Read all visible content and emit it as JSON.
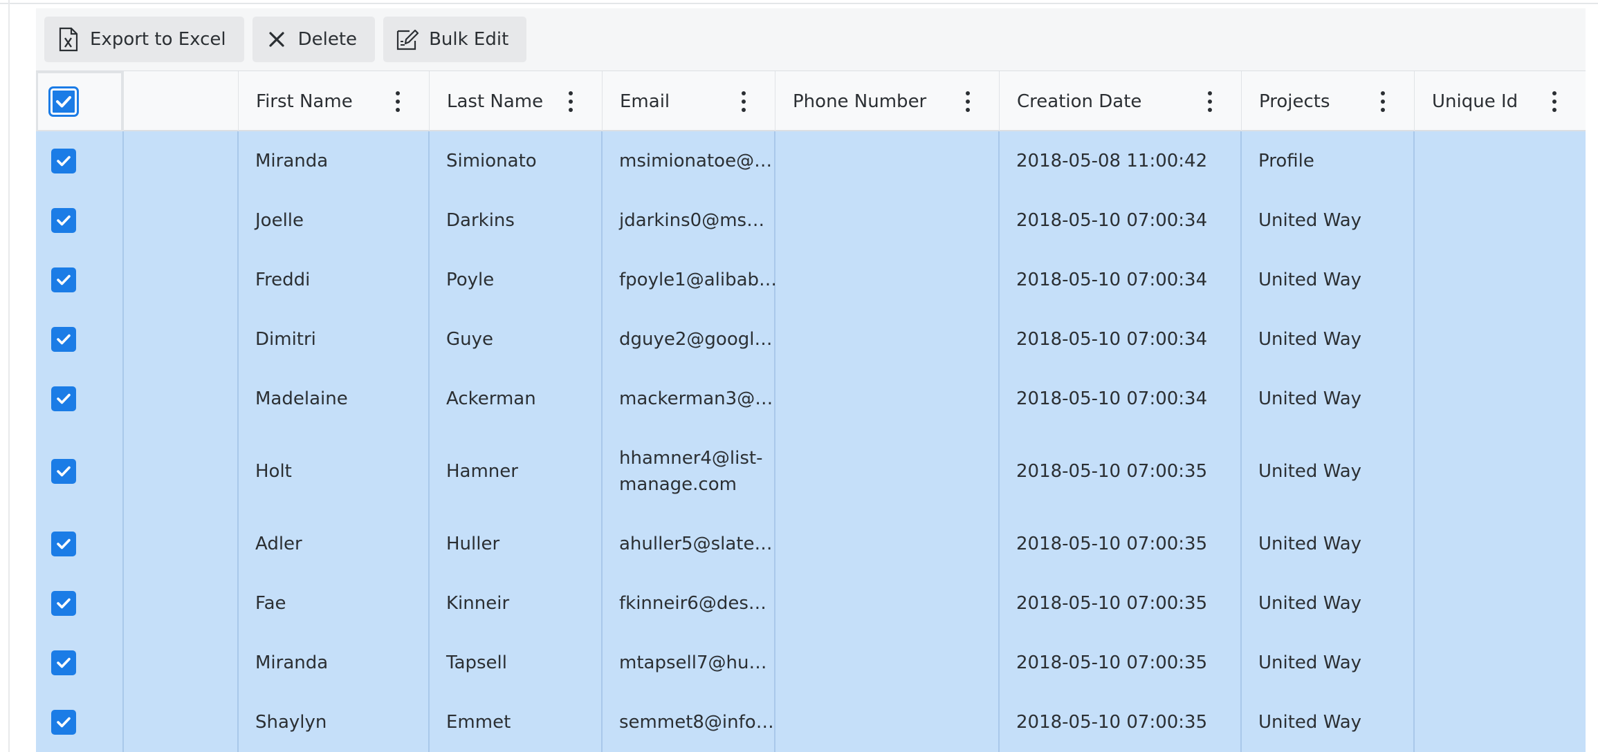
{
  "toolbar": {
    "export_label": "Export to Excel",
    "delete_label": "Delete",
    "bulk_edit_label": "Bulk Edit"
  },
  "columns": [
    {
      "label": "First Name"
    },
    {
      "label": "Last Name"
    },
    {
      "label": "Email"
    },
    {
      "label": "Phone Number"
    },
    {
      "label": "Creation Date"
    },
    {
      "label": "Projects"
    },
    {
      "label": "Unique Id"
    }
  ],
  "header_select_all_checked": true,
  "rows": [
    {
      "checked": true,
      "first": "Miranda",
      "last": "Simionato",
      "email": "msimionatoe@…",
      "phone": "",
      "created": "2018-05-08 11:00:42",
      "projects": "Profile",
      "unique_id": ""
    },
    {
      "checked": true,
      "first": "Joelle",
      "last": "Darkins",
      "email": "jdarkins0@ms…",
      "phone": "",
      "created": "2018-05-10 07:00:34",
      "projects": "United Way",
      "unique_id": ""
    },
    {
      "checked": true,
      "first": "Freddi",
      "last": "Poyle",
      "email": "fpoyle1@alibab…",
      "phone": "",
      "created": "2018-05-10 07:00:34",
      "projects": "United Way",
      "unique_id": ""
    },
    {
      "checked": true,
      "first": "Dimitri",
      "last": "Guye",
      "email": "dguye2@googl…",
      "phone": "",
      "created": "2018-05-10 07:00:34",
      "projects": "United Way",
      "unique_id": ""
    },
    {
      "checked": true,
      "first": "Madelaine",
      "last": "Ackerman",
      "email": "mackerman3@…",
      "phone": "",
      "created": "2018-05-10 07:00:34",
      "projects": "United Way",
      "unique_id": ""
    },
    {
      "checked": true,
      "first": "Holt",
      "last": "Hamner",
      "email": "hhamner4@list-manage.com",
      "phone": "",
      "created": "2018-05-10 07:00:35",
      "projects": "United Way",
      "unique_id": ""
    },
    {
      "checked": true,
      "first": "Adler",
      "last": "Huller",
      "email": "ahuller5@slate…",
      "phone": "",
      "created": "2018-05-10 07:00:35",
      "projects": "United Way",
      "unique_id": ""
    },
    {
      "checked": true,
      "first": "Fae",
      "last": "Kinneir",
      "email": "fkinneir6@des…",
      "phone": "",
      "created": "2018-05-10 07:00:35",
      "projects": "United Way",
      "unique_id": ""
    },
    {
      "checked": true,
      "first": "Miranda",
      "last": "Tapsell",
      "email": "mtapsell7@hu…",
      "phone": "",
      "created": "2018-05-10 07:00:35",
      "projects": "United Way",
      "unique_id": ""
    },
    {
      "checked": true,
      "first": "Shaylyn",
      "last": "Emmet",
      "email": "semmet8@info…",
      "phone": "",
      "created": "2018-05-10 07:00:35",
      "projects": "United Way",
      "unique_id": ""
    }
  ],
  "colors": {
    "selected_row_bg": "#c5dff9",
    "checkbox_blue": "#1b7ce6",
    "header_bg": "#f8f9fa",
    "toolbar_button_bg": "#e7e8ea"
  },
  "icons": {
    "export": "excel-file-icon",
    "delete": "close-x-icon",
    "bulk_edit": "edit-document-icon",
    "column_menu": "kebab-vertical-icon",
    "checkbox": "checkmark-icon"
  }
}
